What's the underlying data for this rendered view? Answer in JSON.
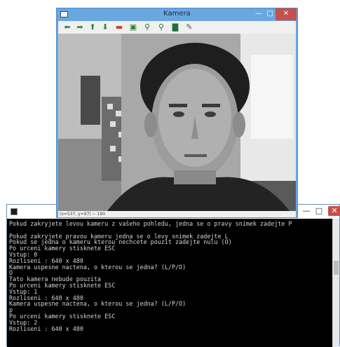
{
  "camera_window": {
    "title": "Kamera",
    "status": "(x=537, y=97) ~ 190",
    "toolbar": [
      {
        "name": "pan-left-icon",
        "glyph": "⬅",
        "color": "#2e8b2e"
      },
      {
        "name": "pan-right-icon",
        "glyph": "➡",
        "color": "#2e8b2e"
      },
      {
        "name": "pan-up-icon",
        "glyph": "⬆",
        "color": "#2e8b2e"
      },
      {
        "name": "pan-down-icon",
        "glyph": "⬇",
        "color": "#2e8b2e"
      },
      {
        "name": "zoom-fit-icon",
        "glyph": "▬",
        "color": "#c04a2a"
      },
      {
        "name": "zoom-rect-icon",
        "glyph": "▣",
        "color": "#2e7d32"
      },
      {
        "name": "zoom-in-icon",
        "glyph": "⚲",
        "color": "#2a6e2a"
      },
      {
        "name": "zoom-out-icon",
        "glyph": "⚲",
        "color": "#2a6e2a"
      },
      {
        "name": "save-icon",
        "glyph": "▇",
        "color": "#1f6f3a"
      },
      {
        "name": "settings-icon",
        "glyph": "✎",
        "color": "#556"
      }
    ]
  },
  "console": {
    "lines": [
      "Pokud zakryjete levou kameru z vašeho pohledu, jedna se o pravy snimek zadejte P",
      "",
      "Pokud zakryjete pravou kameru jedna se o levy snimek zadejte L",
      "Pokud se jedna o kameru kterou nechcete pouzit zadejte nulu (O)",
      "Po urceni kamery stisknete ESC",
      "Vstup: 0",
      "Rozliseni : 640 x 480",
      "Kamera uspesne nactena, o kterou se jedna? (L/P/O)",
      "O",
      "Tato kamera nebude pouzita",
      "Po urceni kamery stisknete ESC",
      "Vstup: 1",
      "Rozliseni : 640 x 480",
      "Kamera uspesne nactena, o kterou se jedna? (L/P/O)",
      "p",
      "Po urceni kamery stisknete ESC",
      "Vstup: 2",
      "Rozliseni : 640 x 480"
    ]
  },
  "colors": {
    "titlebar_active": "#6aa6e0",
    "close_button": "#c7504a",
    "console_bg": "#000000",
    "console_text": "#d4d4d4"
  }
}
